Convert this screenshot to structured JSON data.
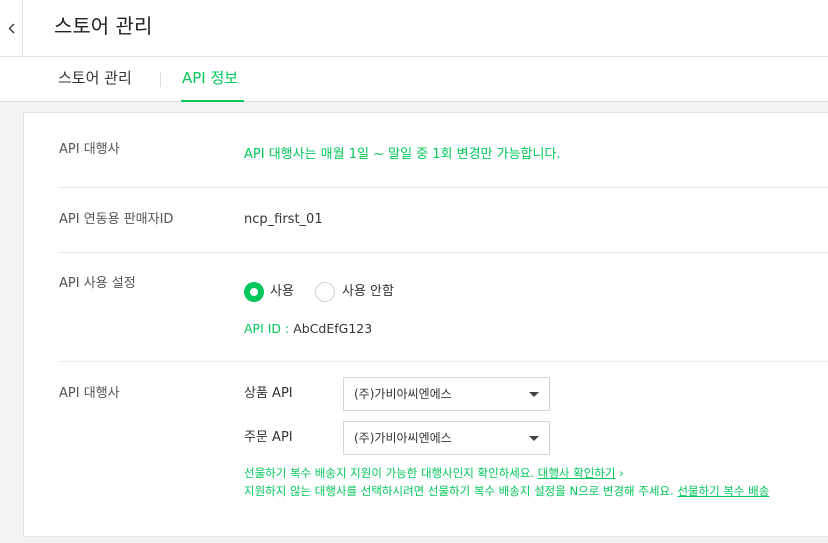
{
  "header": {
    "back_icon": "chevron-left-icon",
    "title": "스토어 관리"
  },
  "tabs": [
    {
      "label": "스토어 관리",
      "active": false
    },
    {
      "label": "API 정보",
      "active": true
    }
  ],
  "rows": {
    "agency_notice": {
      "label": "API 대행사",
      "text": "API 대행사는 매월 1일 ~ 말일 중 1회 변경만 가능합니다."
    },
    "seller_id": {
      "label": "API 연동용 판매자ID",
      "value": "ncp_first_01"
    },
    "usage": {
      "label": "API 사용 설정",
      "options": [
        {
          "label": "사용",
          "selected": true
        },
        {
          "label": "사용 안함",
          "selected": false
        }
      ],
      "api_id_label": "API ID : ",
      "api_id_value": "AbCdEfG123"
    },
    "agency": {
      "label": "API 대행사",
      "product_label": "상품 API",
      "product_value": "(주)가비아씨엔에스",
      "order_label": "주문 API",
      "order_value": "(주)가비아씨엔에스",
      "note1": "선물하기 복수 배송지 지원이 가능한 대행사인지 확인하세요. ",
      "note1_link": "대행사 확인하기",
      "note1_arrow": "›",
      "note2": "지원하지 않는 대행사를 선택하시려면 선물하기 복수 배송지 설정을 N으로 변경해 주세요. ",
      "note2_link": "선물하기 복수 배송"
    }
  },
  "colors": {
    "accent": "#03c75a"
  }
}
